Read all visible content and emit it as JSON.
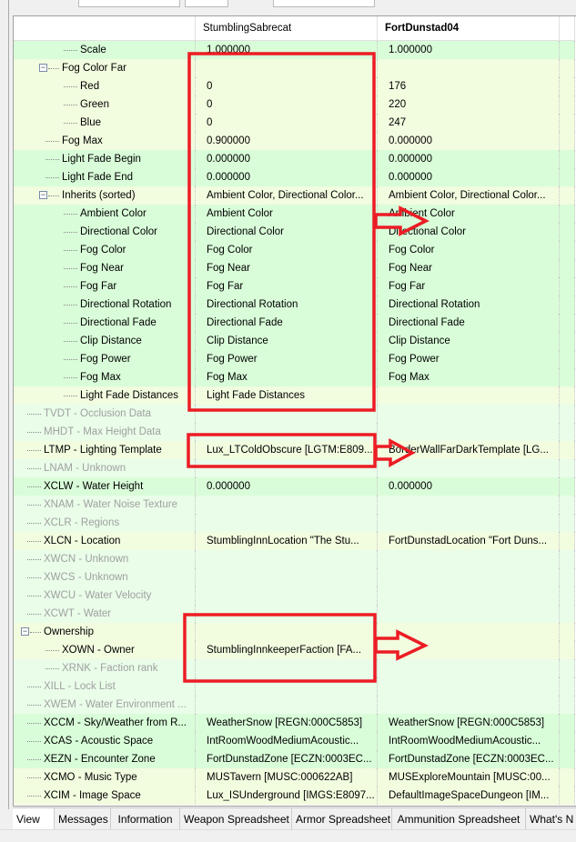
{
  "columns": [
    "",
    "StumblingSabrecat",
    "FortDunstad04"
  ],
  "rows": [
    {
      "label": "Scale",
      "level": 3,
      "v1": "1.000000",
      "v2": "1.000000",
      "bg": "g"
    },
    {
      "label": "Fog Color Far",
      "level": 2,
      "exp": true,
      "v1": "",
      "v2": "",
      "bg": "y"
    },
    {
      "label": "Red",
      "level": 3,
      "v1": "0",
      "v2": "176",
      "bg": "y"
    },
    {
      "label": "Green",
      "level": 3,
      "v1": "0",
      "v2": "220",
      "bg": "y"
    },
    {
      "label": "Blue",
      "level": 3,
      "v1": "0",
      "v2": "247",
      "bg": "y"
    },
    {
      "label": "Fog Max",
      "level": 2,
      "v1": "0.900000",
      "v2": "0.000000",
      "bg": "y"
    },
    {
      "label": "Light Fade Begin",
      "level": 2,
      "v1": "0.000000",
      "v2": "0.000000",
      "bg": "g"
    },
    {
      "label": "Light Fade End",
      "level": 2,
      "v1": "0.000000",
      "v2": "0.000000",
      "bg": "g"
    },
    {
      "label": "Inherits (sorted)",
      "level": 2,
      "exp": true,
      "v1": "Ambient Color, Directional Color...",
      "v2": "Ambient Color, Directional Color...",
      "bg": "y"
    },
    {
      "label": "Ambient Color",
      "level": 3,
      "v1": "Ambient Color",
      "v2": "Ambient Color",
      "bg": "g"
    },
    {
      "label": "Directional Color",
      "level": 3,
      "v1": "Directional Color",
      "v2": "Directional Color",
      "bg": "g"
    },
    {
      "label": "Fog Color",
      "level": 3,
      "v1": "Fog Color",
      "v2": "Fog Color",
      "bg": "g"
    },
    {
      "label": "Fog Near",
      "level": 3,
      "v1": "Fog Near",
      "v2": "Fog Near",
      "bg": "g"
    },
    {
      "label": "Fog Far",
      "level": 3,
      "v1": "Fog Far",
      "v2": "Fog Far",
      "bg": "g"
    },
    {
      "label": "Directional Rotation",
      "level": 3,
      "v1": "Directional Rotation",
      "v2": "Directional Rotation",
      "bg": "g"
    },
    {
      "label": "Directional Fade",
      "level": 3,
      "v1": "Directional Fade",
      "v2": "Directional Fade",
      "bg": "g"
    },
    {
      "label": "Clip Distance",
      "level": 3,
      "v1": "Clip Distance",
      "v2": "Clip Distance",
      "bg": "g"
    },
    {
      "label": "Fog Power",
      "level": 3,
      "v1": "Fog Power",
      "v2": "Fog Power",
      "bg": "g"
    },
    {
      "label": "Fog Max",
      "level": 3,
      "v1": "Fog Max",
      "v2": "Fog Max",
      "bg": "g"
    },
    {
      "label": "Light Fade Distances",
      "level": 3,
      "v1": "Light Fade Distances",
      "v2": "",
      "bg": "y"
    },
    {
      "label": "TVDT - Occlusion Data",
      "level": 1,
      "gray": true,
      "v1": "",
      "v2": "",
      "bg": "l"
    },
    {
      "label": "MHDT - Max Height Data",
      "level": 1,
      "gray": true,
      "v1": "",
      "v2": "",
      "bg": "l"
    },
    {
      "label": "LTMP - Lighting Template",
      "level": 1,
      "v1": "Lux_LTColdObscure [LGTM:E809...",
      "v2": "BorderWallFarDarkTemplate [LG...",
      "bg": "y"
    },
    {
      "label": "LNAM - Unknown",
      "level": 1,
      "gray": true,
      "v1": "",
      "v2": "",
      "bg": "l"
    },
    {
      "label": "XCLW - Water Height",
      "level": 1,
      "v1": "0.000000",
      "v2": "0.000000",
      "bg": "g"
    },
    {
      "label": "XNAM - Water Noise Texture",
      "level": 1,
      "gray": true,
      "v1": "",
      "v2": "",
      "bg": "l"
    },
    {
      "label": "XCLR - Regions",
      "level": 1,
      "gray": true,
      "v1": "",
      "v2": "",
      "bg": "l"
    },
    {
      "label": "XLCN - Location",
      "level": 1,
      "v1": "StumblingInnLocation \"The Stu...",
      "v2": "FortDunstadLocation \"Fort Duns...",
      "bg": "y"
    },
    {
      "label": "XWCN - Unknown",
      "level": 1,
      "gray": true,
      "v1": "",
      "v2": "",
      "bg": "l"
    },
    {
      "label": "XWCS - Unknown",
      "level": 1,
      "gray": true,
      "v1": "",
      "v2": "",
      "bg": "l"
    },
    {
      "label": "XWCU - Water Velocity",
      "level": 1,
      "gray": true,
      "v1": "",
      "v2": "",
      "bg": "l"
    },
    {
      "label": "XCWT - Water",
      "level": 1,
      "gray": true,
      "v1": "",
      "v2": "",
      "bg": "l"
    },
    {
      "label": "Ownership",
      "level": 1,
      "exp": true,
      "v1": "",
      "v2": "",
      "bg": "y"
    },
    {
      "label": "XOWN - Owner",
      "level": 2,
      "v1": "StumblingInnkeeperFaction [FA...",
      "v2": "",
      "bg": "y"
    },
    {
      "label": "XRNK - Faction rank",
      "level": 2,
      "gray": true,
      "v1": "",
      "v2": "",
      "bg": "l"
    },
    {
      "label": "XILL - Lock List",
      "level": 1,
      "gray": true,
      "v1": "",
      "v2": "",
      "bg": "l"
    },
    {
      "label": "XWEM - Water Environment ...",
      "level": 1,
      "gray": true,
      "v1": "",
      "v2": "",
      "bg": "l"
    },
    {
      "label": "XCCM - Sky/Weather from R...",
      "level": 1,
      "v1": "WeatherSnow [REGN:000C5853]",
      "v2": "WeatherSnow [REGN:000C5853]",
      "bg": "g"
    },
    {
      "label": "XCAS - Acoustic Space",
      "level": 1,
      "v1": "IntRoomWoodMediumAcoustic...",
      "v2": "IntRoomWoodMediumAcoustic...",
      "bg": "g"
    },
    {
      "label": "XEZN - Encounter Zone",
      "level": 1,
      "v1": "FortDunstadZone [ECZN:0003EC...",
      "v2": "FortDunstadZone [ECZN:0003EC...",
      "bg": "g"
    },
    {
      "label": "XCMO - Music Type",
      "level": 1,
      "v1": "MUSTavern [MUSC:000622AB]",
      "v2": "MUSExploreMountain [MUSC:00...",
      "bg": "y"
    },
    {
      "label": "XCIM - Image Space",
      "level": 1,
      "v1": "Lux_ISUnderground [IMGS:E8097...",
      "v2": "DefaultImageSpaceDungeon [IM...",
      "bg": "y"
    }
  ],
  "tabs": [
    "View",
    "Messages",
    "Information",
    "Weapon Spreadsheet",
    "Armor Spreadsheet",
    "Ammunition Spreadsheet",
    "What's N"
  ],
  "active_tab": "View",
  "colors": {
    "annotation": "#ec1c24",
    "row_conflict": "#f2fcdf",
    "row_identical": "#d9fdd9",
    "row_empty": "#e9fde9"
  }
}
